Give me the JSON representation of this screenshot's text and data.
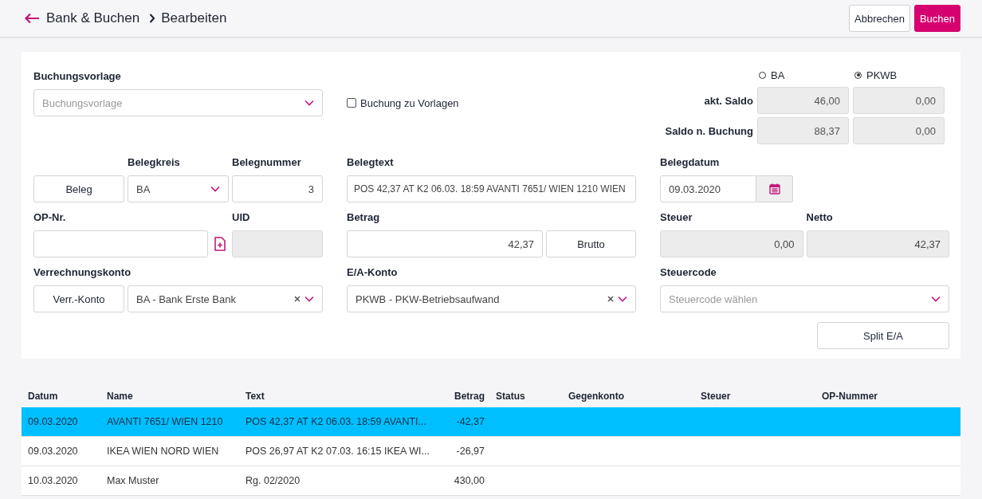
{
  "header": {
    "breadcrumb": [
      {
        "label": "Bank & Buchen"
      },
      {
        "label": "Bearbeiten"
      }
    ],
    "buttons": [
      {
        "label": "Abbrechen",
        "kind": "secondary"
      },
      {
        "label": "Buchen",
        "kind": "primary"
      }
    ]
  },
  "form": {
    "buchungsvorlage": {
      "label": "Buchungsvorlage",
      "placeholder": "Buchungsvorlage"
    },
    "template_checkbox": {
      "label": "Buchung zu Vorlagen",
      "checked": false
    },
    "accounts": [
      {
        "label": "BA",
        "selected": false
      },
      {
        "label": "PKWB",
        "selected": true
      }
    ],
    "balances": [
      {
        "label": "akt. Saldo",
        "values": [
          "46,00",
          "0,00"
        ]
      },
      {
        "label": "Saldo n. Buchung",
        "values": [
          "88,37",
          "0,00"
        ]
      }
    ],
    "beleg_button": "Beleg",
    "belegkreis": {
      "label": "Belegkreis",
      "value": "BA"
    },
    "belegnummer": {
      "label": "Belegnummer",
      "value": "3"
    },
    "belegtext": {
      "label": "Belegtext",
      "value": "POS 42,37 AT K2 06.03. 18:59 AVANTI 7651/ WIEN 1210 WIEN"
    },
    "belegdatum": {
      "label": "Belegdatum",
      "value": "09.03.2020"
    },
    "op_nr": {
      "label": "OP-Nr."
    },
    "uid": {
      "label": "UID",
      "disabled": true
    },
    "betrag": {
      "label": "Betrag",
      "value": "42,37"
    },
    "brutto_button": "Brutto",
    "steuer": {
      "label": "Steuer",
      "value": "0,00",
      "disabled": true
    },
    "netto": {
      "label": "Netto",
      "value": "42,37",
      "disabled": true
    },
    "verrechnungskonto": {
      "label": "Verrechnungskonto",
      "button": "Verr.-Konto",
      "value": "BA - Bank Erste Bank"
    },
    "ea_konto": {
      "label": "E/A-Konto",
      "value": "PKWB - PKW-Betriebsaufwand"
    },
    "steuercode": {
      "label": "Steuercode",
      "placeholder": "Steuercode wählen"
    },
    "split_button": "Split E/A"
  },
  "table": {
    "columns": [
      "Datum",
      "Name",
      "Text",
      "Betrag",
      "Status",
      "Gegenkonto",
      "Steuer",
      "OP-Nummer"
    ],
    "rows": [
      {
        "selected": true,
        "cells": [
          "09.03.2020",
          "AVANTI 7651/ WIEN 1210",
          "POS 42,37 AT K2 06.03. 18:59 AVANTI...",
          "-42,37"
        ]
      },
      {
        "selected": false,
        "cells": [
          "09.03.2020",
          "IKEA WIEN NORD WIEN",
          "POS 26,97 AT K2 07.03. 16:15 IKEA WI...",
          "-26,97"
        ]
      },
      {
        "selected": false,
        "cells": [
          "10.03.2020",
          "Max Muster",
          "Rg. 02/2020",
          "430,00"
        ]
      }
    ]
  }
}
